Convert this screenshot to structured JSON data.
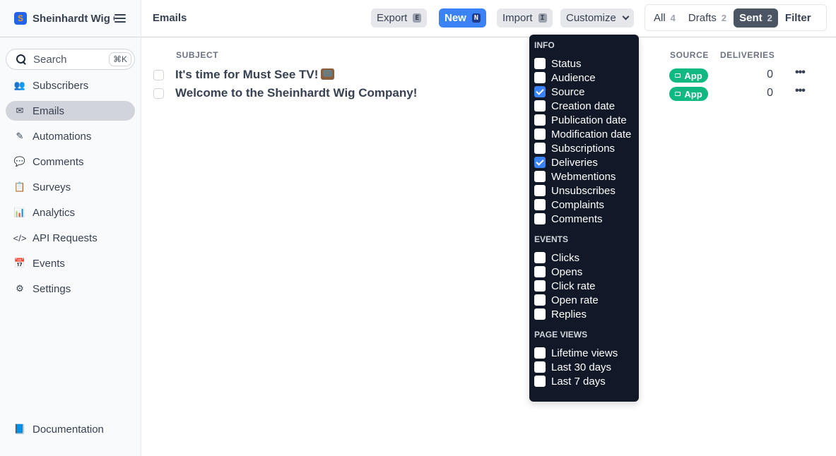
{
  "sidebar": {
    "logo_letter": "S",
    "title": "Sheinhardt Wig Company",
    "search": {
      "label": "Search",
      "shortcut": "⌘K"
    },
    "items": [
      {
        "label": "Subscribers",
        "icon": "users-icon",
        "glyph": "👥",
        "active": false
      },
      {
        "label": "Emails",
        "icon": "envelope-icon",
        "glyph": "✉",
        "active": true
      },
      {
        "label": "Automations",
        "icon": "magic-wand-icon",
        "glyph": "✎",
        "active": false
      },
      {
        "label": "Comments",
        "icon": "comments-icon",
        "glyph": "💬",
        "active": false
      },
      {
        "label": "Surveys",
        "icon": "clipboard-icon",
        "glyph": "📋",
        "active": false
      },
      {
        "label": "Analytics",
        "icon": "bar-chart-icon",
        "glyph": "📊",
        "active": false
      },
      {
        "label": "API Requests",
        "icon": "code-icon",
        "glyph": "</>",
        "active": false
      },
      {
        "label": "Events",
        "icon": "calendar-icon",
        "glyph": "📅",
        "active": false
      },
      {
        "label": "Settings",
        "icon": "gear-icon",
        "glyph": "⚙",
        "active": false
      }
    ],
    "documentation": {
      "label": "Documentation",
      "icon": "book-icon",
      "glyph": "📘"
    }
  },
  "header": {
    "title": "Emails",
    "export": {
      "label": "Export",
      "key": "E"
    },
    "new": {
      "label": "New",
      "key": "N"
    },
    "import": {
      "label": "Import",
      "key": "I"
    },
    "customize": {
      "label": "Customize"
    },
    "tabs": [
      {
        "label": "All",
        "count": "4",
        "active": false
      },
      {
        "label": "Drafts",
        "count": "2",
        "active": false
      },
      {
        "label": "Sent",
        "count": "2",
        "active": true
      }
    ],
    "filter_label": "Filter"
  },
  "table": {
    "columns": {
      "subject": "SUBJECT",
      "source": "SOURCE",
      "deliveries": "DELIVERIES"
    },
    "rows": [
      {
        "subject": "It's time for Must See TV!",
        "has_tv_emoji": true,
        "source": "App",
        "deliveries": "0"
      },
      {
        "subject": "Welcome to the Sheinhardt Wig Company!",
        "has_tv_emoji": false,
        "source": "App",
        "deliveries": "0"
      }
    ]
  },
  "customize_menu": {
    "sections": [
      {
        "title": "INFO",
        "items": [
          {
            "label": "Status",
            "checked": false
          },
          {
            "label": "Audience",
            "checked": false
          },
          {
            "label": "Source",
            "checked": true
          },
          {
            "label": "Creation date",
            "checked": false
          },
          {
            "label": "Publication date",
            "checked": false
          },
          {
            "label": "Modification date",
            "checked": false
          },
          {
            "label": "Subscriptions",
            "checked": false
          },
          {
            "label": "Deliveries",
            "checked": true
          },
          {
            "label": "Webmentions",
            "checked": false
          },
          {
            "label": "Unsubscribes",
            "checked": false
          },
          {
            "label": "Complaints",
            "checked": false
          },
          {
            "label": "Comments",
            "checked": false
          }
        ]
      },
      {
        "title": "EVENTS",
        "items": [
          {
            "label": "Clicks",
            "checked": false
          },
          {
            "label": "Opens",
            "checked": false
          },
          {
            "label": "Click rate",
            "checked": false
          },
          {
            "label": "Open rate",
            "checked": false
          },
          {
            "label": "Replies",
            "checked": false
          }
        ]
      },
      {
        "title": "PAGE VIEWS",
        "items": [
          {
            "label": "Lifetime views",
            "checked": false
          },
          {
            "label": "Last 30 days",
            "checked": false
          },
          {
            "label": "Last 7 days",
            "checked": false
          }
        ]
      }
    ]
  },
  "colors": {
    "primary": "#3b82f6",
    "badge_green": "#10b981",
    "menu_bg": "#111827",
    "active_tab": "#4b5563"
  }
}
